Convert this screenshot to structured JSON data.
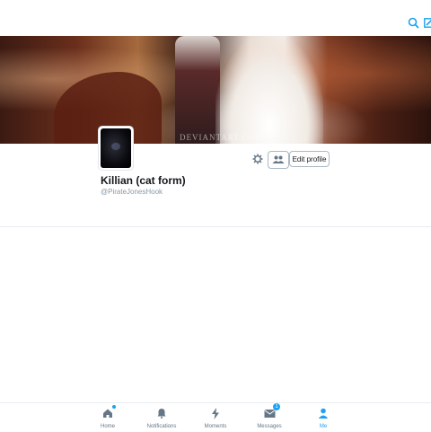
{
  "topbar": {
    "search_icon": "search-icon",
    "compose_icon": "compose-icon",
    "accent_color": "#1da1f2"
  },
  "banner": {
    "watermark": "DEVIANTART.COM"
  },
  "profile": {
    "name": "Killian (cat form)",
    "handle": "@PirateJonesHook",
    "edit_label": "Edit profile"
  },
  "tabs": [
    {
      "label": "Home",
      "icon": "home-icon",
      "badge": ""
    },
    {
      "label": "Notifications",
      "icon": "bell-icon",
      "badge": ""
    },
    {
      "label": "Moments",
      "icon": "lightning-icon",
      "badge": ""
    },
    {
      "label": "Messages",
      "icon": "envelope-icon",
      "badge": "1"
    },
    {
      "label": "Me",
      "icon": "person-icon",
      "badge": ""
    }
  ]
}
